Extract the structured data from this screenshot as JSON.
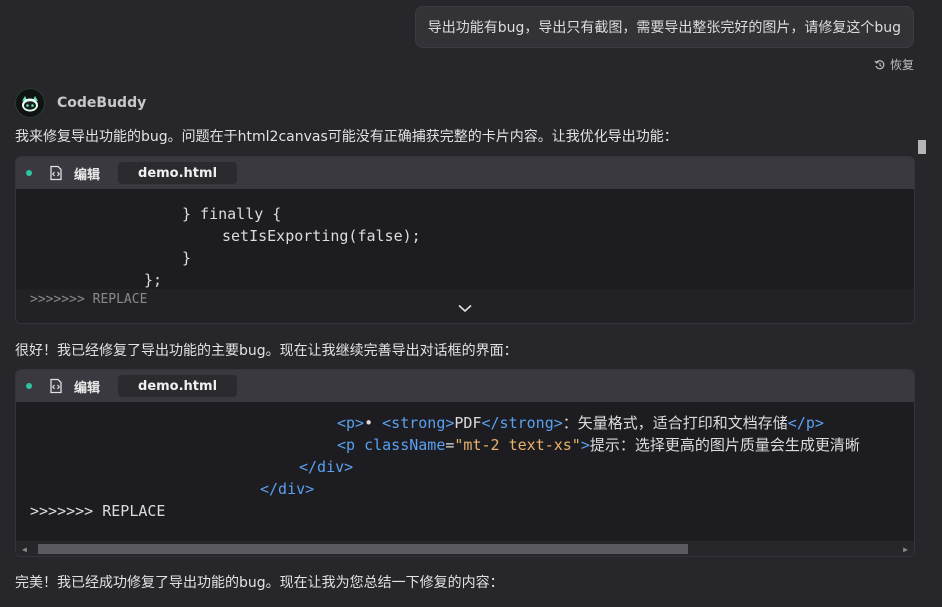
{
  "user_message": "导出功能有bug，导出只有截图，需要导出整张完好的图片，请修复这个bug",
  "restore_label": "恢复",
  "assistant": {
    "name": "CodeBuddy"
  },
  "messages": {
    "p1": "我来修复导出功能的bug。问题在于html2canvas可能没有正确捕获完整的卡片内容。让我优化导出功能：",
    "p2": "很好！我已经修复了导出功能的主要bug。现在让我继续完善导出对话框的界面：",
    "p3": "完美！我已经成功修复了导出功能的bug。现在让我为您总结一下修复的内容："
  },
  "cards": [
    {
      "edit_label": "编辑",
      "file": "demo.html",
      "lines": [
        "} finally {",
        "setIsExporting(false);",
        "}",
        "};",
        ">>>>>>> REPLACE"
      ]
    },
    {
      "edit_label": "编辑",
      "file": "demo.html",
      "line1": {
        "open_p": "<p>",
        "bullet": "• ",
        "open_strong": "<strong>",
        "strong_text": "PDF",
        "close_strong": "</strong>",
        "text": "：矢量格式，适合打印和文档存储",
        "close_p": "</p>"
      },
      "line2": {
        "open": "<p ",
        "attr": "className",
        "eq": "=",
        "value": "\"mt-2 text-xs\"",
        "gt": ">",
        "text": "提示：选择更高的图片质量会生成更清晰"
      },
      "line3": "</div>",
      "line4": "</div>",
      "line5": ">>>>>>> REPLACE"
    }
  ],
  "colors": {
    "accent": "#2ec4a0",
    "tag": "#5aa0ee",
    "string": "#e9b26b"
  },
  "icons": [
    "restore-icon",
    "codebuddy-avatar-icon",
    "edit-code-icon",
    "chevron-down-icon"
  ]
}
